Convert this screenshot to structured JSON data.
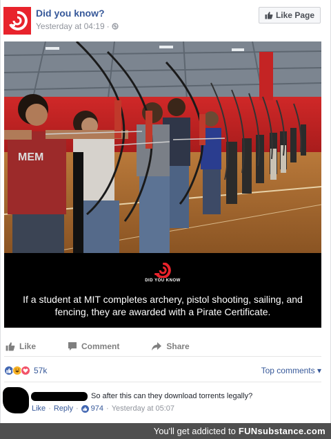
{
  "post": {
    "page_name": "Did you know?",
    "timestamp": "Yesterday at 04:19",
    "separator": "·",
    "privacy_icon": "globe-icon",
    "like_page_label": "Like Page"
  },
  "photo": {
    "logo_text": "DID YOU KNOW",
    "caption": "If a student at MIT completes archery, pistol shooting, sailing, and fencing, they are awarded with a Pirate Certificate.",
    "shirt_text": "MEM"
  },
  "actions": [
    {
      "label": "Like",
      "icon": "thumbs-up-icon"
    },
    {
      "label": "Comment",
      "icon": "comment-icon"
    },
    {
      "label": "Share",
      "icon": "share-icon"
    }
  ],
  "reactions": {
    "count": "57k",
    "icons": [
      "like-reaction",
      "haha-reaction",
      "love-reaction"
    ],
    "top_comments_label": "Top comments ▾"
  },
  "comment": {
    "text": "So after this can they download torrents legally?",
    "like_label": "Like",
    "reply_label": "Reply",
    "like_count": "974",
    "timestamp": "Yesterday at 05:07",
    "separator": "·"
  },
  "watermark": {
    "text": "You'll get addicted to",
    "brand": "FUNsubstance.com"
  },
  "colors": {
    "facebook_blue": "#365899",
    "logo_red": "#e8232c",
    "watermark_bg": "#4f4f4f"
  }
}
